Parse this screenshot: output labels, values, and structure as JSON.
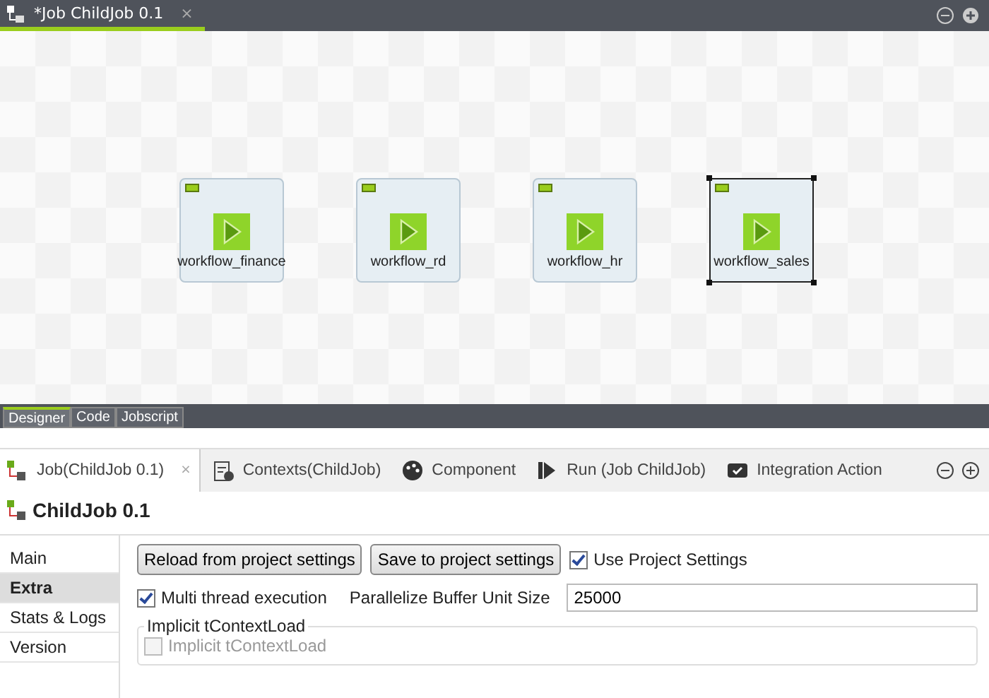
{
  "editor_tabs": [
    {
      "label": "*Job ChildJob 0.1",
      "close": "×",
      "selected": true
    }
  ],
  "canvas": {
    "nodes": [
      {
        "label": "workflow_finance",
        "selected": false
      },
      {
        "label": "workflow_rd",
        "selected": false
      },
      {
        "label": "workflow_hr",
        "selected": false
      },
      {
        "label": "workflow_sales",
        "selected": true
      }
    ]
  },
  "view_tabs": [
    {
      "label": "Designer",
      "selected": true
    },
    {
      "label": "Code",
      "selected": false
    },
    {
      "label": "Jobscript",
      "selected": false
    }
  ],
  "panel_tabs": [
    {
      "label": "Job(ChildJob 0.1)",
      "kind": "job",
      "close": "×",
      "selected": true
    },
    {
      "label": "Contexts(ChildJob)",
      "kind": "contexts",
      "selected": false
    },
    {
      "label": "Component",
      "kind": "component",
      "selected": false
    },
    {
      "label": "Run (Job ChildJob)",
      "kind": "run",
      "selected": false
    },
    {
      "label": "Integration Action",
      "kind": "integration",
      "selected": false
    }
  ],
  "panel_title": "ChildJob 0.1",
  "sidebar": {
    "items": [
      {
        "label": "Main",
        "selected": false
      },
      {
        "label": "Extra",
        "selected": true
      },
      {
        "label": "Stats & Logs",
        "selected": false
      },
      {
        "label": "Version",
        "selected": false
      }
    ]
  },
  "extra": {
    "reload_button": "Reload from project settings",
    "save_button": "Save to project settings",
    "use_project_settings": {
      "label": "Use Project Settings",
      "checked": true
    },
    "multi_thread": {
      "label": "Multi thread execution",
      "checked": true
    },
    "buffer": {
      "label": "Parallelize Buffer Unit Size",
      "value": "25000"
    },
    "implicit_group": {
      "title": "Implicit tContextLoad",
      "checkbox": {
        "label": "Implicit tContextLoad",
        "checked": false,
        "disabled": true
      }
    }
  }
}
